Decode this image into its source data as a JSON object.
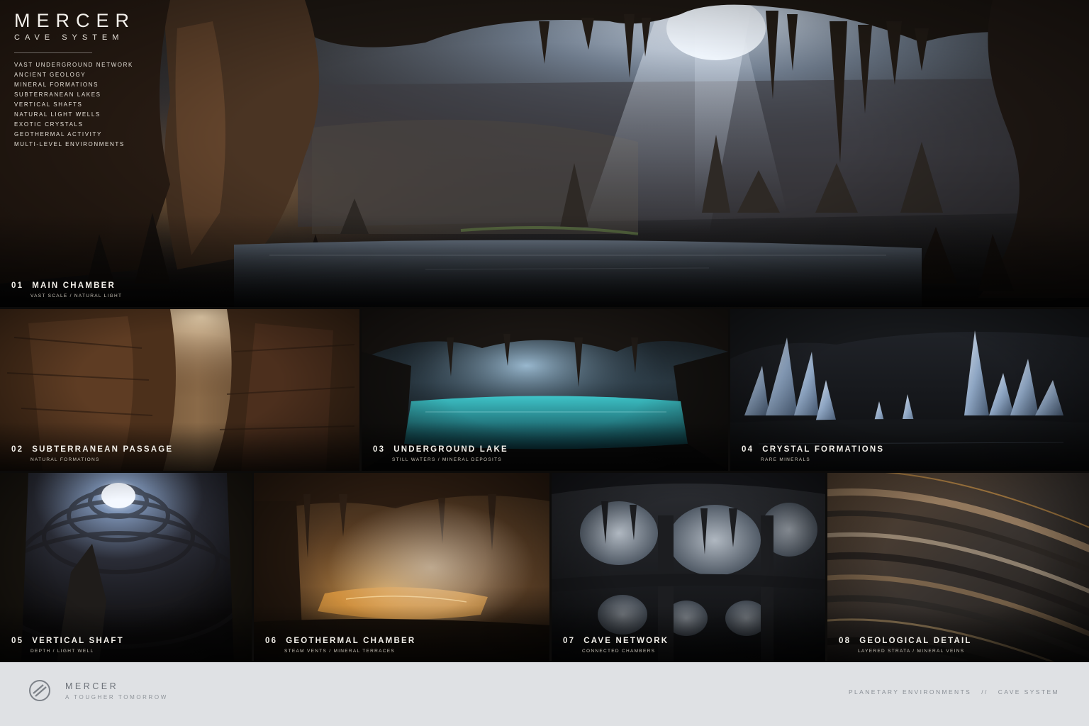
{
  "header": {
    "brand": "MERCER",
    "subtitle": "CAVE SYSTEM",
    "features": [
      "VAST UNDERGROUND NETWORK",
      "ANCIENT GEOLOGY",
      "MINERAL FORMATIONS",
      "SUBTERRANEAN LAKES",
      "VERTICAL SHAFTS",
      "NATURAL LIGHT WELLS",
      "EXOTIC CRYSTALS",
      "GEOTHERMAL ACTIVITY",
      "MULTI-LEVEL ENVIRONMENTS"
    ]
  },
  "panels": [
    {
      "num": "01",
      "title": "MAIN CHAMBER",
      "subtitle": "VAST SCALE / NATURAL LIGHT"
    },
    {
      "num": "02",
      "title": "SUBTERRANEAN PASSAGE",
      "subtitle": "NATURAL FORMATIONS"
    },
    {
      "num": "03",
      "title": "UNDERGROUND LAKE",
      "subtitle": "STILL WATERS / MINERAL DEPOSITS"
    },
    {
      "num": "04",
      "title": "CRYSTAL FORMATIONS",
      "subtitle": "RARE MINERALS"
    },
    {
      "num": "05",
      "title": "VERTICAL SHAFT",
      "subtitle": "DEPTH / LIGHT WELL"
    },
    {
      "num": "06",
      "title": "GEOTHERMAL CHAMBER",
      "subtitle": "STEAM VENTS / MINERAL TERRACES"
    },
    {
      "num": "07",
      "title": "CAVE NETWORK",
      "subtitle": "CONNECTED CHAMBERS"
    },
    {
      "num": "08",
      "title": "GEOLOGICAL DETAIL",
      "subtitle": "LAYERED STRATA / MINERAL VEINS"
    }
  ],
  "footer": {
    "brand": "MERCER",
    "tagline": "A TOUGHER TOMORROW",
    "section": "PLANETARY ENVIRONMENTS",
    "separator": "//",
    "page": "CAVE SYSTEM"
  },
  "colors": {
    "footer_bg": "#dfe1e4",
    "footer_text": "#8a8f96",
    "caption_text": "#f2efe9",
    "rock_warm": "#6b4a2e",
    "light_cool": "#a9c6e6",
    "lake_teal": "#2aa3a8",
    "lava_glow": "#e0a04a"
  },
  "icons": {
    "logo": "mercer-logo-icon"
  }
}
